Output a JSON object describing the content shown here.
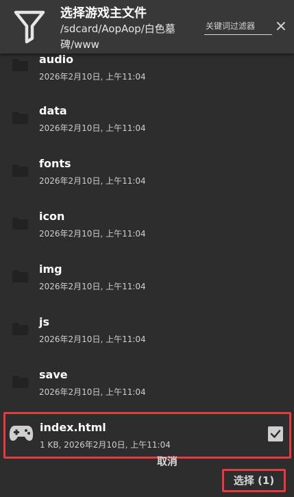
{
  "header": {
    "title": "选择游戏主文件",
    "path": "/sdcard/AopAop/白色墓碑/www",
    "search_placeholder": "关键词过滤器",
    "filter_icon": "filter-icon",
    "clear_icon": "close-icon"
  },
  "items": [
    {
      "name": "audio",
      "meta": "2026年2月10日, 上午11:04",
      "icon": "folder-icon"
    },
    {
      "name": "data",
      "meta": "2026年2月10日, 上午11:04",
      "icon": "folder-icon"
    },
    {
      "name": "fonts",
      "meta": "2026年2月10日, 上午11:04",
      "icon": "folder-icon"
    },
    {
      "name": "icon",
      "meta": "2026年2月10日, 上午11:04",
      "icon": "folder-icon"
    },
    {
      "name": "img",
      "meta": "2026年2月10日, 上午11:04",
      "icon": "folder-icon"
    },
    {
      "name": "js",
      "meta": "2026年2月10日, 上午11:04",
      "icon": "folder-icon"
    },
    {
      "name": "save",
      "meta": "2026年2月10日, 上午11:04",
      "icon": "folder-icon"
    }
  ],
  "selected_file": {
    "name": "index.html",
    "meta": "1 KB, 2026年2月10日, 上午11:04",
    "icon": "gamepad-icon",
    "checked": true
  },
  "footer": {
    "cancel_label": "取消",
    "select_label": "选择 (1)"
  },
  "colors": {
    "background": "#2d2d2d",
    "header": "#383838",
    "highlight": "#e9393f",
    "text": "#ffffff"
  }
}
